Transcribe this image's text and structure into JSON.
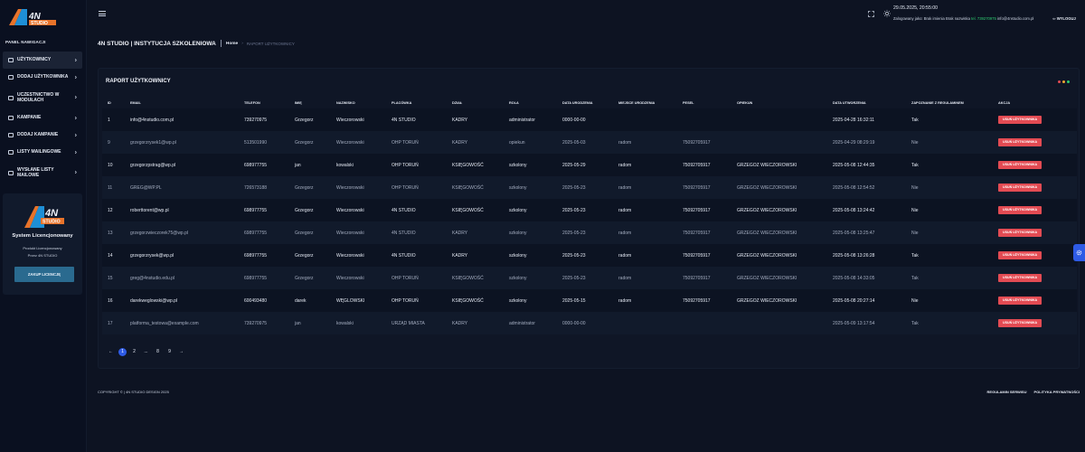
{
  "brand": {
    "logo_text": "4N STUDIO"
  },
  "sidebar": {
    "heading": "PANEL NAWIGACJI",
    "items": [
      {
        "label": "UŻYTKOWNICY",
        "active": true
      },
      {
        "label": "DODAJ UŻYTKOWNIKA",
        "active": false
      },
      {
        "label": "UCZESTNICTWO W MODUŁACH",
        "active": false
      },
      {
        "label": "KAMPANIE",
        "active": false
      },
      {
        "label": "DODAJ KAMPANIE",
        "active": false
      },
      {
        "label": "LISTY MAILINGOWE",
        "active": false
      },
      {
        "label": "WYSŁANE LISTY MAILOWE",
        "active": false
      }
    ],
    "promo": {
      "title": "System Licencjonowany",
      "line1": "Produkt Licencjonowany",
      "line2": "Przez 4N STUDIO",
      "button": "ZAKUP LICENCJĘ"
    }
  },
  "header": {
    "datetime": "29.05.2025, 20:55:00",
    "logged_prefix": "Zalogowany jako: Brak imienia Brak nazwiska",
    "phone": "tel. 739270975",
    "email": "info@4nstudio.com.pl",
    "logout": "WYLOGUJ"
  },
  "breadcrumb": {
    "title": "4N STUDIO | INSTYTUCJA SZKOLENIOWA",
    "home": "Home",
    "current": "RAPORT UŻYTKOWNICY"
  },
  "report": {
    "title": "RAPORT UŻYTKOWNICY",
    "dot_colors": [
      "#e34b53",
      "#f0a830",
      "#2ecc71"
    ],
    "columns": [
      "ID",
      "EMAIL",
      "TELEFON",
      "IMIĘ",
      "NAZWISKO",
      "PLACÓWKA",
      "DZIAŁ",
      "ROLA",
      "DATA URODZENIA",
      "MIEJSCE URODZENIA",
      "PESEL",
      "OPIEKUN",
      "DATA UTWORZENIA",
      "ZAPOZNANIE Z REGULAMINEM",
      "AKCJA"
    ],
    "delete_label": "USUŃ UŻYTKOWNIKA",
    "rows": [
      [
        "1",
        "info@4nstudio.com.pl",
        "739270975",
        "Grzegorz",
        "Wieczorowski",
        "4N STUDIO",
        "KADRY",
        "administrator",
        "0000-00-00",
        "",
        "",
        "",
        "2025-04-28 16:32:11",
        "Tak"
      ],
      [
        "9",
        "grzegorzrysek1@wp.pl",
        "513501990",
        "Grzegorz",
        "Wieczorowski",
        "OHP TORUŃ",
        "KADRY",
        "opiekun",
        "2025-05-03",
        "radom",
        "75092705917",
        "",
        "2025-04-29 08:29:19",
        "Nie"
      ],
      [
        "10",
        "grzegorzpstrag@wp.pl",
        "698977755",
        "jan",
        "kowalski",
        "OHP TORUŃ",
        "KSIĘGOWOŚĆ",
        "szkolony",
        "2025-05-29",
        "radom",
        "75092705917",
        "GRZEGOZ WIECZOROWSKI",
        "2025-05-08 12:44:35",
        "Tak"
      ],
      [
        "11",
        "GREG@WP.PL",
        "726573188",
        "Grzegorz",
        "Wieczorowski",
        "OHP TORUŃ",
        "KSIĘGOWOŚĆ",
        "szkolony",
        "2025-05-23",
        "radom",
        "75092705917",
        "GRZEGOZ WIECZOROWSKI",
        "2025-05-08 12:54:52",
        "Nie"
      ],
      [
        "12",
        "roberttorent@wp.pl",
        "698977755",
        "Grzegorz",
        "Wieczorowski",
        "4N STUDIO",
        "KSIĘGOWOŚĆ",
        "szkolony",
        "2025-05-23",
        "radom",
        "75092705917",
        "GRZEGOZ WIECZOROWSKI",
        "2025-05-08 13:24:42",
        "Nie"
      ],
      [
        "13",
        "grzegorzwieczorek75@wp.pl",
        "698977755",
        "Grzegorz",
        "Wieczorowski",
        "4N STUDIO",
        "KADRY",
        "szkolony",
        "2025-05-23",
        "radom",
        "75092705917",
        "GRZEGOZ WIECZOROWSKI",
        "2025-05-08 13:25:47",
        "Nie"
      ],
      [
        "14",
        "grzegorzrysek@wp.pl",
        "698977755",
        "Grzegorz",
        "Wieczorowski",
        "4N STUDIO",
        "KADRY",
        "szkolony",
        "2025-05-23",
        "radom",
        "75092705917",
        "GRZEGOZ WIECZOROWSKI",
        "2025-05-08 13:26:28",
        "Tak"
      ],
      [
        "15",
        "greg@4nstudio.edu.pl",
        "698977755",
        "Grzegorz",
        "Wieczorowski",
        "OHP TORUŃ",
        "KSIĘGOWOŚĆ",
        "szkolony",
        "2025-05-23",
        "radom",
        "75092705917",
        "GRZEGOZ WIECZOROWSKI",
        "2025-05-08 14:33:05",
        "Tak"
      ],
      [
        "16",
        "darekweglowski@wp.pl",
        "600493480",
        "darek",
        "WĘGLOWSKI",
        "OHP TORUŃ",
        "KSIĘGOWOŚĆ",
        "szkolony",
        "2025-05-15",
        "radom",
        "75092705917",
        "GRZEGOZ WIECZOROWSKI",
        "2025-05-08 20:27:14",
        "Nie"
      ],
      [
        "17",
        "platforma_testowa@example.com",
        "739270975",
        "jan",
        "kowalski",
        "URZĄD MIASTA",
        "KADRY",
        "administrator",
        "0000-00-00",
        "",
        "",
        "",
        "2025-05-09 13:17:54",
        "Tak"
      ]
    ]
  },
  "pagination": {
    "prev": "←",
    "pages": [
      "1",
      "2",
      "...",
      "8",
      "9"
    ],
    "active_page": "1",
    "next": "→"
  },
  "footer": {
    "copyright": "COPYRIGHT © | 4N STUDIO DESIGN 2025",
    "links": [
      "REGULAMIN SERWISU",
      "POLITYKA PRYWATNOŚCI"
    ]
  }
}
